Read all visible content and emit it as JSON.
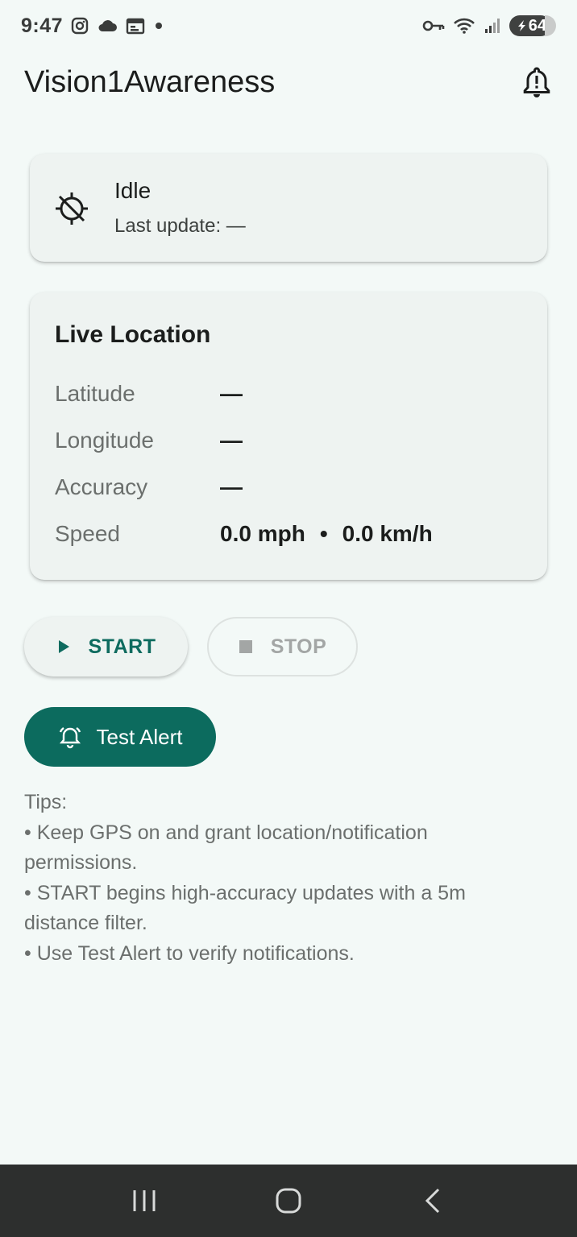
{
  "status_bar": {
    "time": "9:47",
    "battery": "64",
    "icons": [
      "instagram-icon",
      "cloud-icon",
      "calendar-icon",
      "dot-icon",
      "vpn-key-icon",
      "wifi-icon",
      "signal-icon",
      "battery-icon"
    ]
  },
  "app_bar": {
    "title": "Vision1Awareness",
    "action_icon": "notification-alert-icon"
  },
  "status_card": {
    "icon": "gps-off-icon",
    "state": "Idle",
    "last_update": "Last update: —"
  },
  "location_card": {
    "title": "Live Location",
    "rows": [
      {
        "label": "Latitude",
        "value": "—"
      },
      {
        "label": "Longitude",
        "value": "—"
      },
      {
        "label": "Accuracy",
        "value": "—"
      }
    ],
    "speed": {
      "label": "Speed",
      "mph": "0.0 mph",
      "separator": "•",
      "kmh": "0.0 km/h"
    }
  },
  "controls": {
    "start_label": "START",
    "stop_label": "STOP",
    "test_alert_label": "Test Alert"
  },
  "tips": {
    "heading": "Tips:",
    "lines": [
      "• Keep GPS on and grant location/notification permissions.",
      "• START begins high-accuracy updates with a 5m distance filter.",
      "• Use Test Alert to verify notifications."
    ]
  },
  "colors": {
    "accent": "#0c6b5e",
    "background": "#f3f9f7",
    "card": "#eef3f1",
    "nav_bar": "#2d2f2e"
  }
}
